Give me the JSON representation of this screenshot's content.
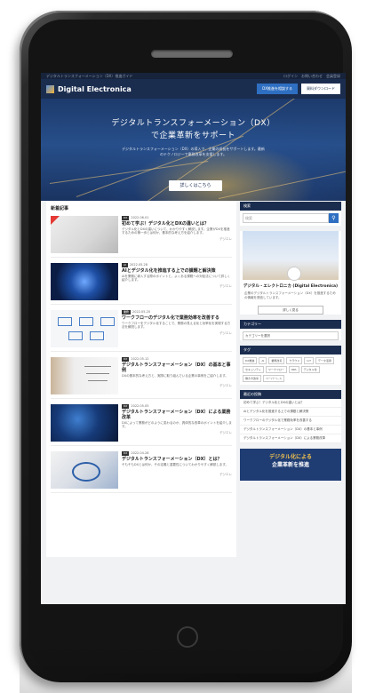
{
  "topstrip": {
    "left": "デジタルトランスフォーメーション（DX）推進ガイド",
    "right": "ログイン　お問い合わせ　会員登録"
  },
  "navbar": {
    "brand": "Digital Electronica",
    "btn_primary": "DX推進を相談する",
    "btn_secondary": "資料ダウンロード"
  },
  "hero": {
    "title_line1": "デジタルトランスフォーメーション（DX）",
    "title_line2": "で企業革新をサポート",
    "subtitle": "デジタルトランスフォーメーション（DX）の導入で、企業の成長をサポートします。最新のテクノロジーで業務改革を支援します。",
    "cta": "詳しくはこちら"
  },
  "main": {
    "section_title": "新着記事",
    "articles": [
      {
        "cat": "DX",
        "date": "2022.06.01",
        "title": "初めて学ぶ！デジタル化とDXの違いとは？",
        "excerpt": "デジタル化とDXの違いについて、わかりやすく解説します。企業がDXを推進するための第一歩とは何か、基本的な考え方を紹介します。",
        "author": "デジエレ"
      },
      {
        "cat": "AI",
        "date": "2022.05.28",
        "title": "AIとデジタル化を推進する上での課題と解決策",
        "excerpt": "AIを業務に導入する際のポイントと、よくある課題への対処法について詳しく紹介します。",
        "author": "デジエレ"
      },
      {
        "cat": "業務",
        "date": "2022.05.20",
        "title": "ワークフローのデジタル化で業務効率を改善する",
        "excerpt": "ワークフローをデジタル化することで、業務の見える化と効率化を実現する方法を解説します。",
        "author": "デジエレ"
      },
      {
        "cat": "DX",
        "date": "2022.05.12",
        "title": "デジタルトランスフォーメーション（DX）の基本と事例",
        "excerpt": "DXの基本的な考え方と、実際に取り組んでいる企業の事例をご紹介します。",
        "author": "デジエレ"
      },
      {
        "cat": "DX",
        "date": "2022.05.05",
        "title": "デジタルトランスフォーメーション（DX）による業務改革",
        "excerpt": "DXによって業務がどのように変わるのか、具体的な改革のポイントを紹介します。",
        "author": "デジエレ"
      },
      {
        "cat": "DX",
        "date": "2022.04.28",
        "title": "デジタルトランスフォーメーション（DX）とは？",
        "excerpt": "そもそもDXとは何か、その定義と重要性についてわかりやすく解説します。",
        "author": "デジエレ"
      }
    ]
  },
  "sidebar": {
    "search_title": "検索",
    "search_placeholder": "検索",
    "profile_title": "プロフィール",
    "profile_name": "デジタル・エレクトロニカ (Digital Electronica)",
    "profile_desc": "企業のデジタルトランスフォーメーション（DX）を推進するための情報を発信しています。",
    "profile_btn": "詳しく見る",
    "category_title": "カテゴリー",
    "category_select": "カテゴリーを選択",
    "tags_title": "タグ",
    "tags": [
      "DX推進",
      "AI",
      "業務改善",
      "クラウド",
      "IoT",
      "データ活用",
      "セキュリティ",
      "ワークフロー",
      "RPA",
      "デジタル化",
      "働き方改革",
      "ペーパーレス"
    ],
    "recent_title": "最近の投稿",
    "recent": [
      "初めて学ぶ！デジタル化とDXの違いとは？",
      "AIとデジタル化を推進する上での課題と解決策",
      "ワークフローのデジタル化で業務効率を改善する",
      "デジタルトランスフォーメーション（DX）の基本と事例",
      "デジタルトランスフォーメーション（DX）による業務改革"
    ],
    "banner_line1": "デジタル化による",
    "banner_line2": "企業革新を推進"
  }
}
